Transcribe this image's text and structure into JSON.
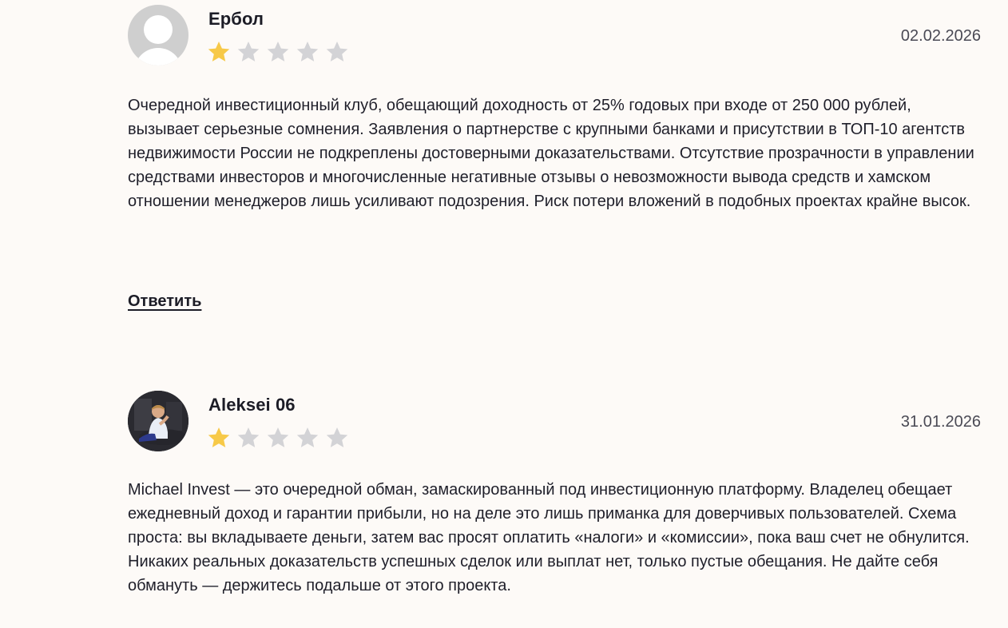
{
  "reviews": [
    {
      "author": "Ербол",
      "date": "02.02.2026",
      "rating": 1,
      "rating_max": 5,
      "avatar": "default-user-avatar",
      "text": "Очередной инвестиционный клуб, обещающий доходность от 25% годовых при входе от 250 000 рублей, вызывает серьезные сомнения. Заявления о партнерстве с крупными банками и присутствии в ТОП-10 агентств недвижимости России не подкреплены достоверными доказательствами. Отсутствие прозрачности в управлении средствами инвесторов и многочисленные негативные отзывы о невозможности вывода средств и хамском отношении менеджеров лишь усиливают подозрения. Риск потери вложений в подобных проектах крайне высок.",
      "reply_label": "Ответить"
    },
    {
      "author": "Aleksei 06",
      "date": "31.01.2026",
      "rating": 1,
      "rating_max": 5,
      "avatar": "user-photo-avatar",
      "text": "Michael Invest — это очередной обман, замаскированный под инвестиционную платформу. Владелец обещает ежедневный доход и гарантии прибыли, но на деле это лишь приманка для доверчивых пользователей. Схема проста: вы вкладываете деньги, затем вас просят оплатить «налоги» и «комиссии», пока ваш счет не обнулится. Никаких реальных доказательств успешных сделок или выплат нет, только пустые обещания. Не дайте себя обмануть — держитесь подальше от этого проекта."
    }
  ],
  "colors": {
    "star_filled": "#f7c948",
    "star_empty": "#d3d3d6",
    "text": "#1f1f2a",
    "background": "#fdfaf7"
  }
}
